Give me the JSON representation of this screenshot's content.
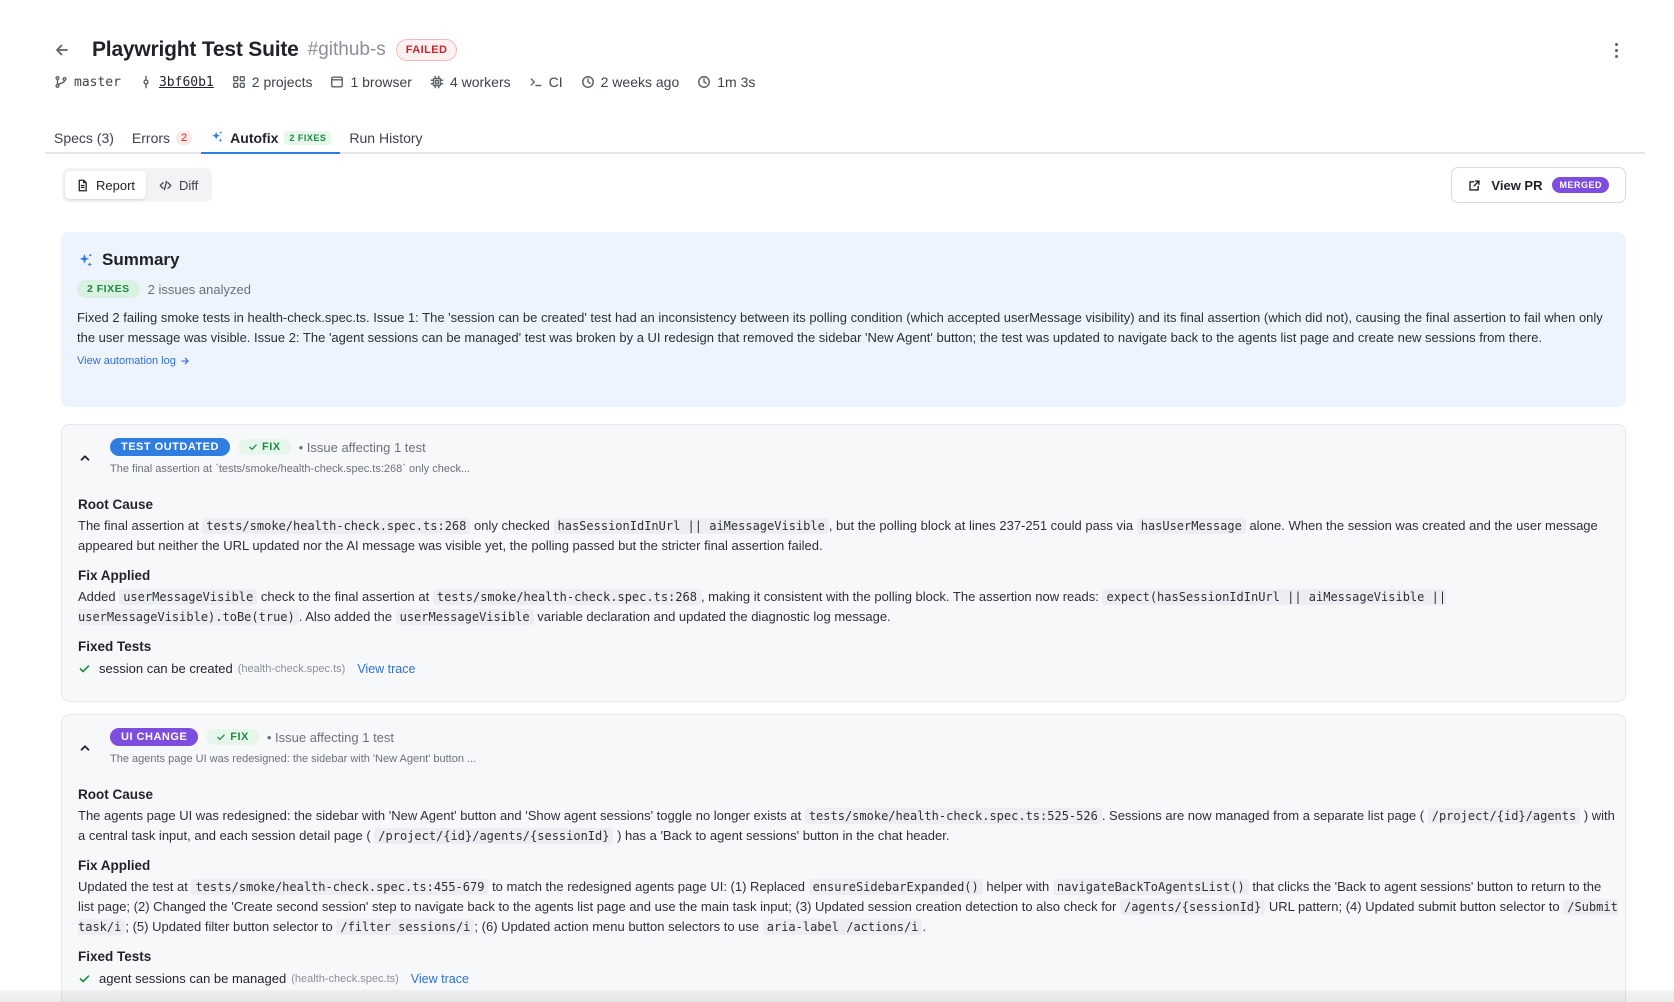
{
  "header": {
    "title": "Playwright Test Suite",
    "repo_tag": "#github-s",
    "status": "FAILED"
  },
  "meta": {
    "branch": "master",
    "commit": "3bf60b1",
    "projects": "2 projects",
    "browsers": "1 browser",
    "workers": "4 workers",
    "environment": "CI",
    "time_ago": "2 weeks ago",
    "duration": "1m 3s"
  },
  "tabs": [
    {
      "label": "Specs (3)"
    },
    {
      "label": "Errors",
      "badge": "2"
    },
    {
      "label": "Autofix",
      "badge": "2 FIXES"
    },
    {
      "label": "Run History"
    }
  ],
  "toolbar": {
    "report_label": "Report",
    "diff_label": "Diff",
    "view_pr_label": "View PR",
    "pr_status": "MERGED"
  },
  "summary": {
    "title": "Summary",
    "fixes_badge": "2 FIXES",
    "issues_analyzed": "2 issues analyzed",
    "text": "Fixed 2 failing smoke tests in health-check.spec.ts. Issue 1: The 'session can be created' test had an inconsistency between its polling condition (which accepted userMessage visibility) and its final assertion (which did not), causing the final assertion to fail when only the user message was visible. Issue 2: The 'agent sessions can be managed' test was broken by a UI redesign that removed the sidebar 'New Agent' button; the test was updated to navigate back to the agents list page and create new sessions from there.",
    "log_link": "View automation log"
  },
  "issues": [
    {
      "type": "TEST OUTDATED",
      "fix_label": "FIX",
      "affecting": "• Issue affecting 1 test",
      "description": "The final assertion at `tests/smoke/health-check.spec.ts:268` only check...",
      "root_cause_title": "Root Cause",
      "root_cause": [
        "The final assertion at ",
        "tests/smoke/health-check.spec.ts:268",
        " only checked ",
        "hasSessionIdInUrl || aiMessageVisible",
        ", but the polling block at lines 237-251 could pass via ",
        "hasUserMessage",
        " alone. When the session was created and the user message appeared but neither the URL updated nor the AI message was visible yet, the polling passed but the stricter final assertion failed."
      ],
      "fix_title": "Fix Applied",
      "fix": [
        "Added ",
        "userMessageVisible",
        " check to the final assertion at ",
        "tests/smoke/health-check.spec.ts:268",
        ", making it consistent with the polling block. The assertion now reads: ",
        "expect(hasSessionIdInUrl || aiMessageVisible || userMessageVisible).toBe(true)",
        ". Also added the ",
        "userMessageVisible",
        " variable declaration and updated the diagnostic log message."
      ],
      "tests_title": "Fixed Tests",
      "tests": [
        {
          "name": "session can be created",
          "file": "(health-check.spec.ts)",
          "link": "View trace"
        }
      ]
    },
    {
      "type": "UI CHANGE",
      "fix_label": "FIX",
      "affecting": "• Issue affecting 1 test",
      "description": "The agents page UI was redesigned: the sidebar with 'New Agent' button ...",
      "root_cause_title": "Root Cause",
      "root_cause": [
        "The agents page UI was redesigned: the sidebar with 'New Agent' button and 'Show agent sessions' toggle no longer exists at ",
        "tests/smoke/health-check.spec.ts:525-526",
        ". Sessions are now managed from a separate list page ( ",
        "/project/{id}/agents",
        " ) with a central task input, and each session detail page ( ",
        "/project/{id}/agents/{sessionId}",
        " ) has a 'Back to agent sessions' button in the chat header."
      ],
      "fix_title": "Fix Applied",
      "fix": [
        "Updated the test at ",
        "tests/smoke/health-check.spec.ts:455-679",
        " to match the redesigned agents page UI: (1) Replaced ",
        "ensureSidebarExpanded()",
        " helper with ",
        "navigateBackToAgentsList()",
        " that clicks the 'Back to agent sessions' button to return to the list page; (2) Changed the 'Create second session' step to navigate back to the agents list page and use the main task input; (3) Updated session creation detection to also check for ",
        "/agents/{sessionId}",
        " URL pattern; (4) Updated submit button selector to ",
        "/Submit task/i",
        "; (5) Updated filter button selector to ",
        "/filter sessions/i",
        "; (6) Updated action menu button selectors to use ",
        "aria-label /actions/i",
        "."
      ],
      "tests_title": "Fixed Tests",
      "tests": [
        {
          "name": "agent sessions can be managed",
          "file": "(health-check.spec.ts)",
          "link": "View trace"
        }
      ]
    }
  ],
  "icons": {
    "back": "arrow-left-icon",
    "more": "kebab-icon",
    "branch": "git-branch-icon",
    "commit": "git-commit-icon",
    "projects": "grid-icon",
    "browser": "browser-icon",
    "workers": "cpu-icon",
    "ci": "terminal-icon",
    "time": "clock-icon",
    "sparkle": "sparkle-icon"
  },
  "colors": {
    "failed": "#c8252d",
    "accent": "#2f7de1",
    "purple": "#7d4de0",
    "green": "#1e8a43",
    "summary_bg": "#edf4fd"
  }
}
